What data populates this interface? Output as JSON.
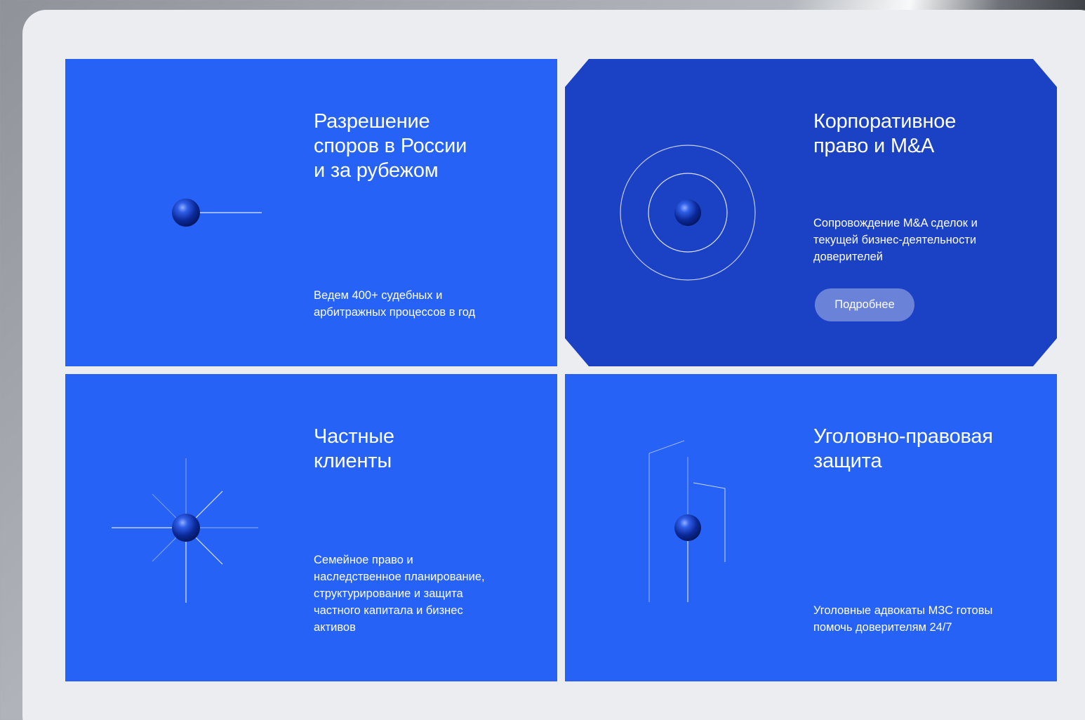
{
  "cards": [
    {
      "title": "Разрешение\nспоров в России\nи за рубежом",
      "description": "Ведем 400+ судебных и\nарбитражных процессов в год",
      "illustration": "sphere-with-horizontal-line-icon"
    },
    {
      "title": "Корпоративное\nправо и M&A",
      "description": "Сопровождение M&A сделок и\nтекущей бизнес-деятельности\nдоверителей",
      "button_label": "Подробнее",
      "illustration": "sphere-with-rings-icon"
    },
    {
      "title": "Частные\nклиенты",
      "description": "Семейное право и\nнаследственное планирование,\nструктурирование и защита\nчастного капитала и бизнес\nактивов",
      "illustration": "sphere-with-rays-icon"
    },
    {
      "title": "Уголовно-правовая\nзащита",
      "description": "Уголовные адвокаты МЗС готовы\nпомочь доверителям 24/7",
      "illustration": "sphere-with-door-lines-icon"
    }
  ],
  "colors": {
    "card_blue": "#2662f6",
    "card_dark_blue": "#1b41c5",
    "panel_bg": "#ecedf1",
    "text": "#ffffff"
  }
}
